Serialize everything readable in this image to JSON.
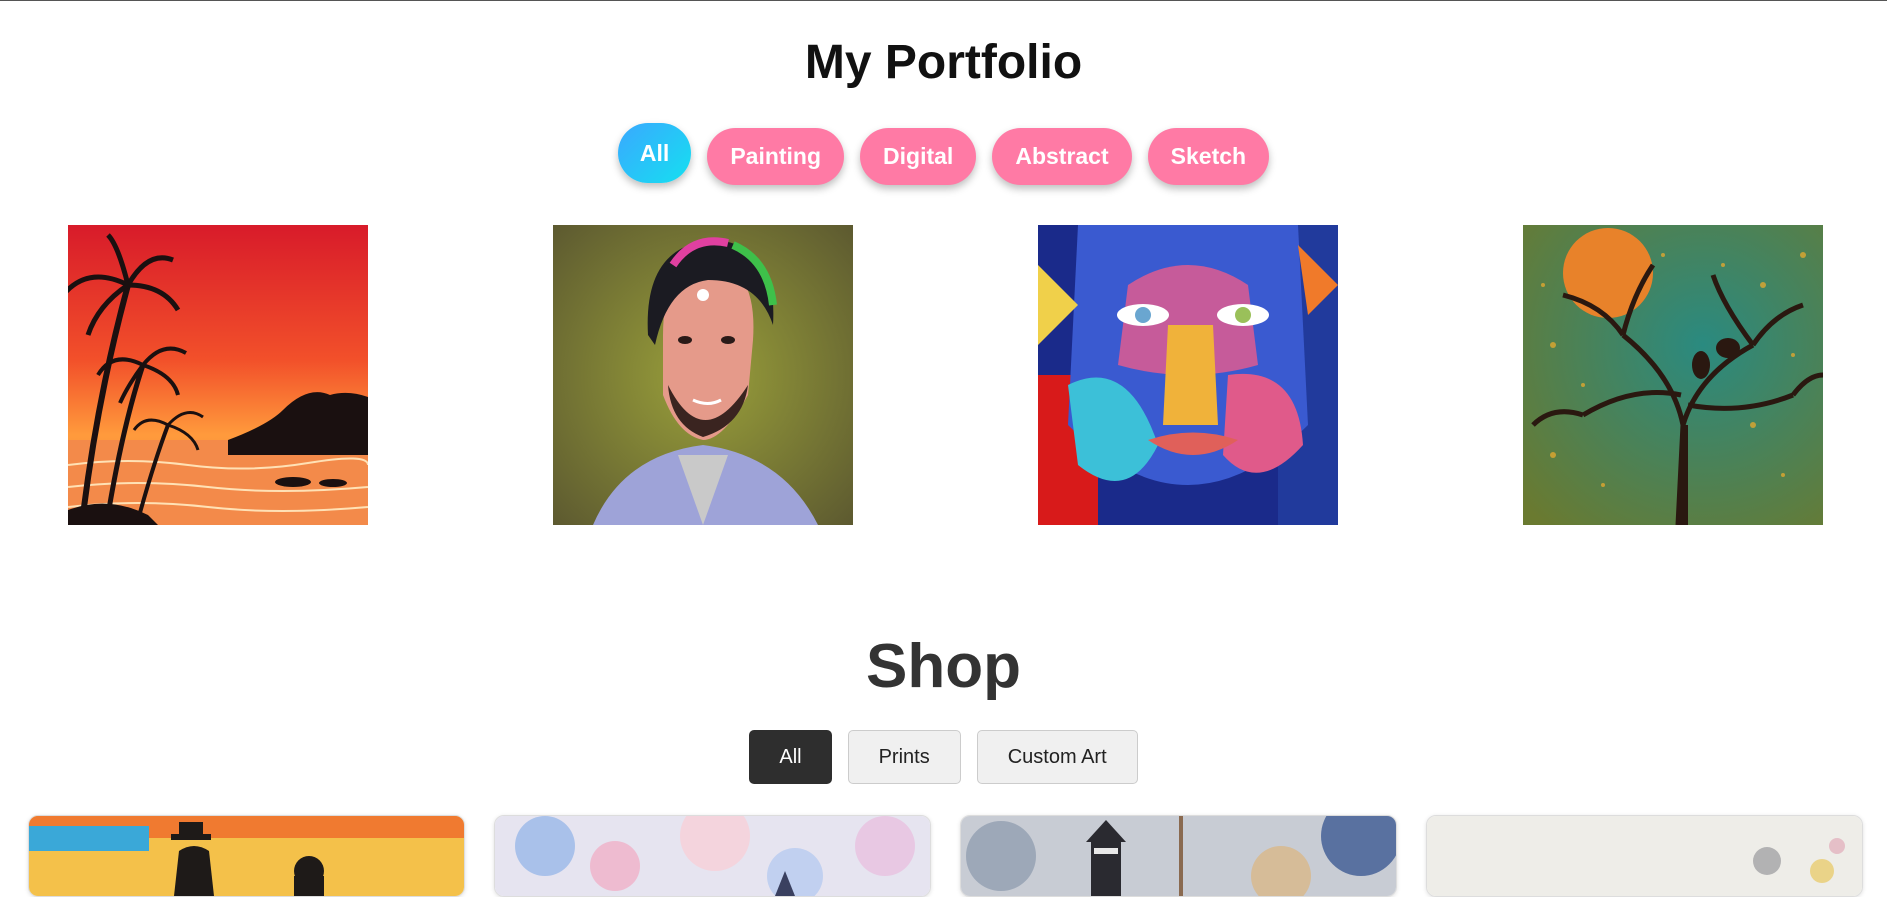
{
  "portfolio": {
    "title": "My Portfolio",
    "filters": [
      "All",
      "Painting",
      "Digital",
      "Abstract",
      "Sketch"
    ],
    "active_filter": "All",
    "artworks": [
      {
        "name": "sunset-palm-painting"
      },
      {
        "name": "man-portrait-digital"
      },
      {
        "name": "colorful-face-abstract"
      },
      {
        "name": "tree-moon-painting"
      }
    ]
  },
  "shop": {
    "title": "Shop",
    "tabs": [
      "All",
      "Prints",
      "Custom Art"
    ],
    "active_tab": "All",
    "products": [
      {
        "name": "couple-sunset-print"
      },
      {
        "name": "pastel-watercolor-print"
      },
      {
        "name": "lighthouse-watercolor-print"
      },
      {
        "name": "minimal-watercolor-print"
      }
    ]
  },
  "colors": {
    "pill": "#ff7aa5",
    "pill_active_start": "#3aa8ff",
    "pill_active_end": "#15e0f0",
    "tab_active": "#2e2e2e",
    "tab": "#f0f0f0"
  }
}
